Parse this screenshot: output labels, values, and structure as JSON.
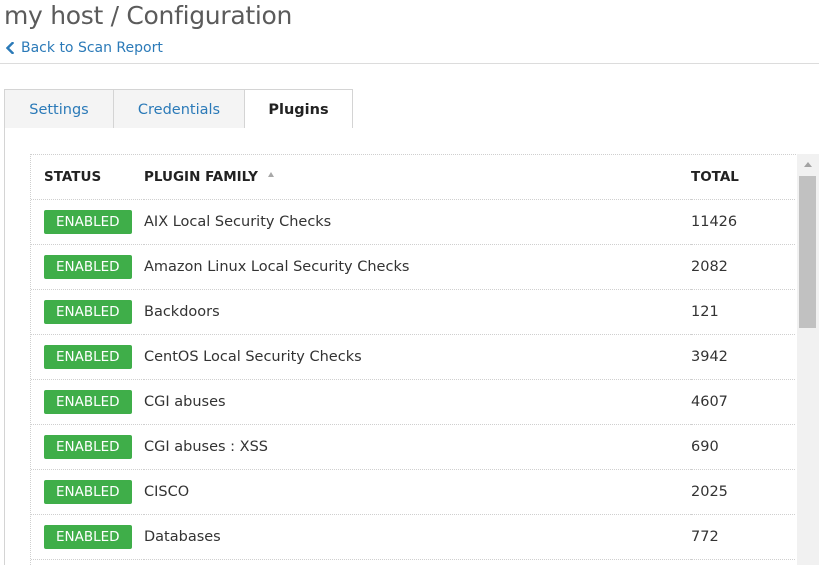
{
  "header": {
    "title": "my host / Configuration",
    "back_label": "Back to Scan Report"
  },
  "tabs": [
    {
      "label": "Settings",
      "active": false
    },
    {
      "label": "Credentials",
      "active": false
    },
    {
      "label": "Plugins",
      "active": true
    }
  ],
  "table": {
    "columns": {
      "status": "STATUS",
      "family": "PLUGIN FAMILY",
      "total": "TOTAL"
    },
    "sort": {
      "column": "family",
      "direction": "ascending"
    },
    "rows": [
      {
        "status": "ENABLED",
        "family": "AIX Local Security Checks",
        "total": "11426"
      },
      {
        "status": "ENABLED",
        "family": "Amazon Linux Local Security Checks",
        "total": "2082"
      },
      {
        "status": "ENABLED",
        "family": "Backdoors",
        "total": "121"
      },
      {
        "status": "ENABLED",
        "family": "CentOS Local Security Checks",
        "total": "3942"
      },
      {
        "status": "ENABLED",
        "family": "CGI abuses",
        "total": "4607"
      },
      {
        "status": "ENABLED",
        "family": "CGI abuses : XSS",
        "total": "690"
      },
      {
        "status": "ENABLED",
        "family": "CISCO",
        "total": "2025"
      },
      {
        "status": "ENABLED",
        "family": "Databases",
        "total": "772"
      }
    ]
  },
  "colors": {
    "link": "#2b7ab8",
    "enabled_badge": "#3fae49"
  },
  "icons": {
    "back": "chevron-left-icon",
    "sort": "sort-ascending-icon"
  }
}
